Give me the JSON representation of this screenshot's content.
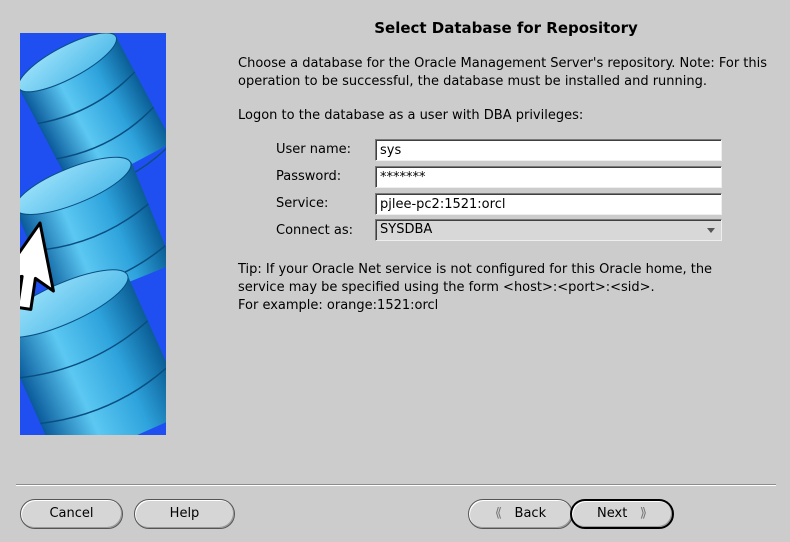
{
  "dialog": {
    "title": "Select Database for Repository",
    "intro": "Choose a database for the Oracle Management Server's repository. Note: For this operation to be successful, the database must be installed and running.",
    "logon_instruction": "Logon to the database as a user with DBA privileges:"
  },
  "form": {
    "username": {
      "label": "User name:",
      "value": "sys"
    },
    "password": {
      "label": "Password:",
      "value": "*******"
    },
    "service": {
      "label": "Service:",
      "value": "pjlee-pc2:1521:orcl"
    },
    "connect_as": {
      "label": "Connect as:",
      "value": "SYSDBA"
    }
  },
  "tip": {
    "line1": "Tip: If your Oracle Net service is not configured for this Oracle home, the",
    "line2": "service may be specified using the form <host>:<port>:<sid>.",
    "line3": "For example: orange:1521:orcl"
  },
  "buttons": {
    "cancel": "Cancel",
    "help": "Help",
    "back": "Back",
    "next": "Next"
  },
  "icons": {
    "illustration": "database-cylinders-cursor-illustration",
    "back": "chevron-left-icon",
    "next": "chevron-right-icon",
    "dropdown": "dropdown-arrow-icon"
  },
  "colors": {
    "background": "#cccccc",
    "illustration_bg": "#1f4ff0",
    "cylinder": "#3fb8ec"
  }
}
